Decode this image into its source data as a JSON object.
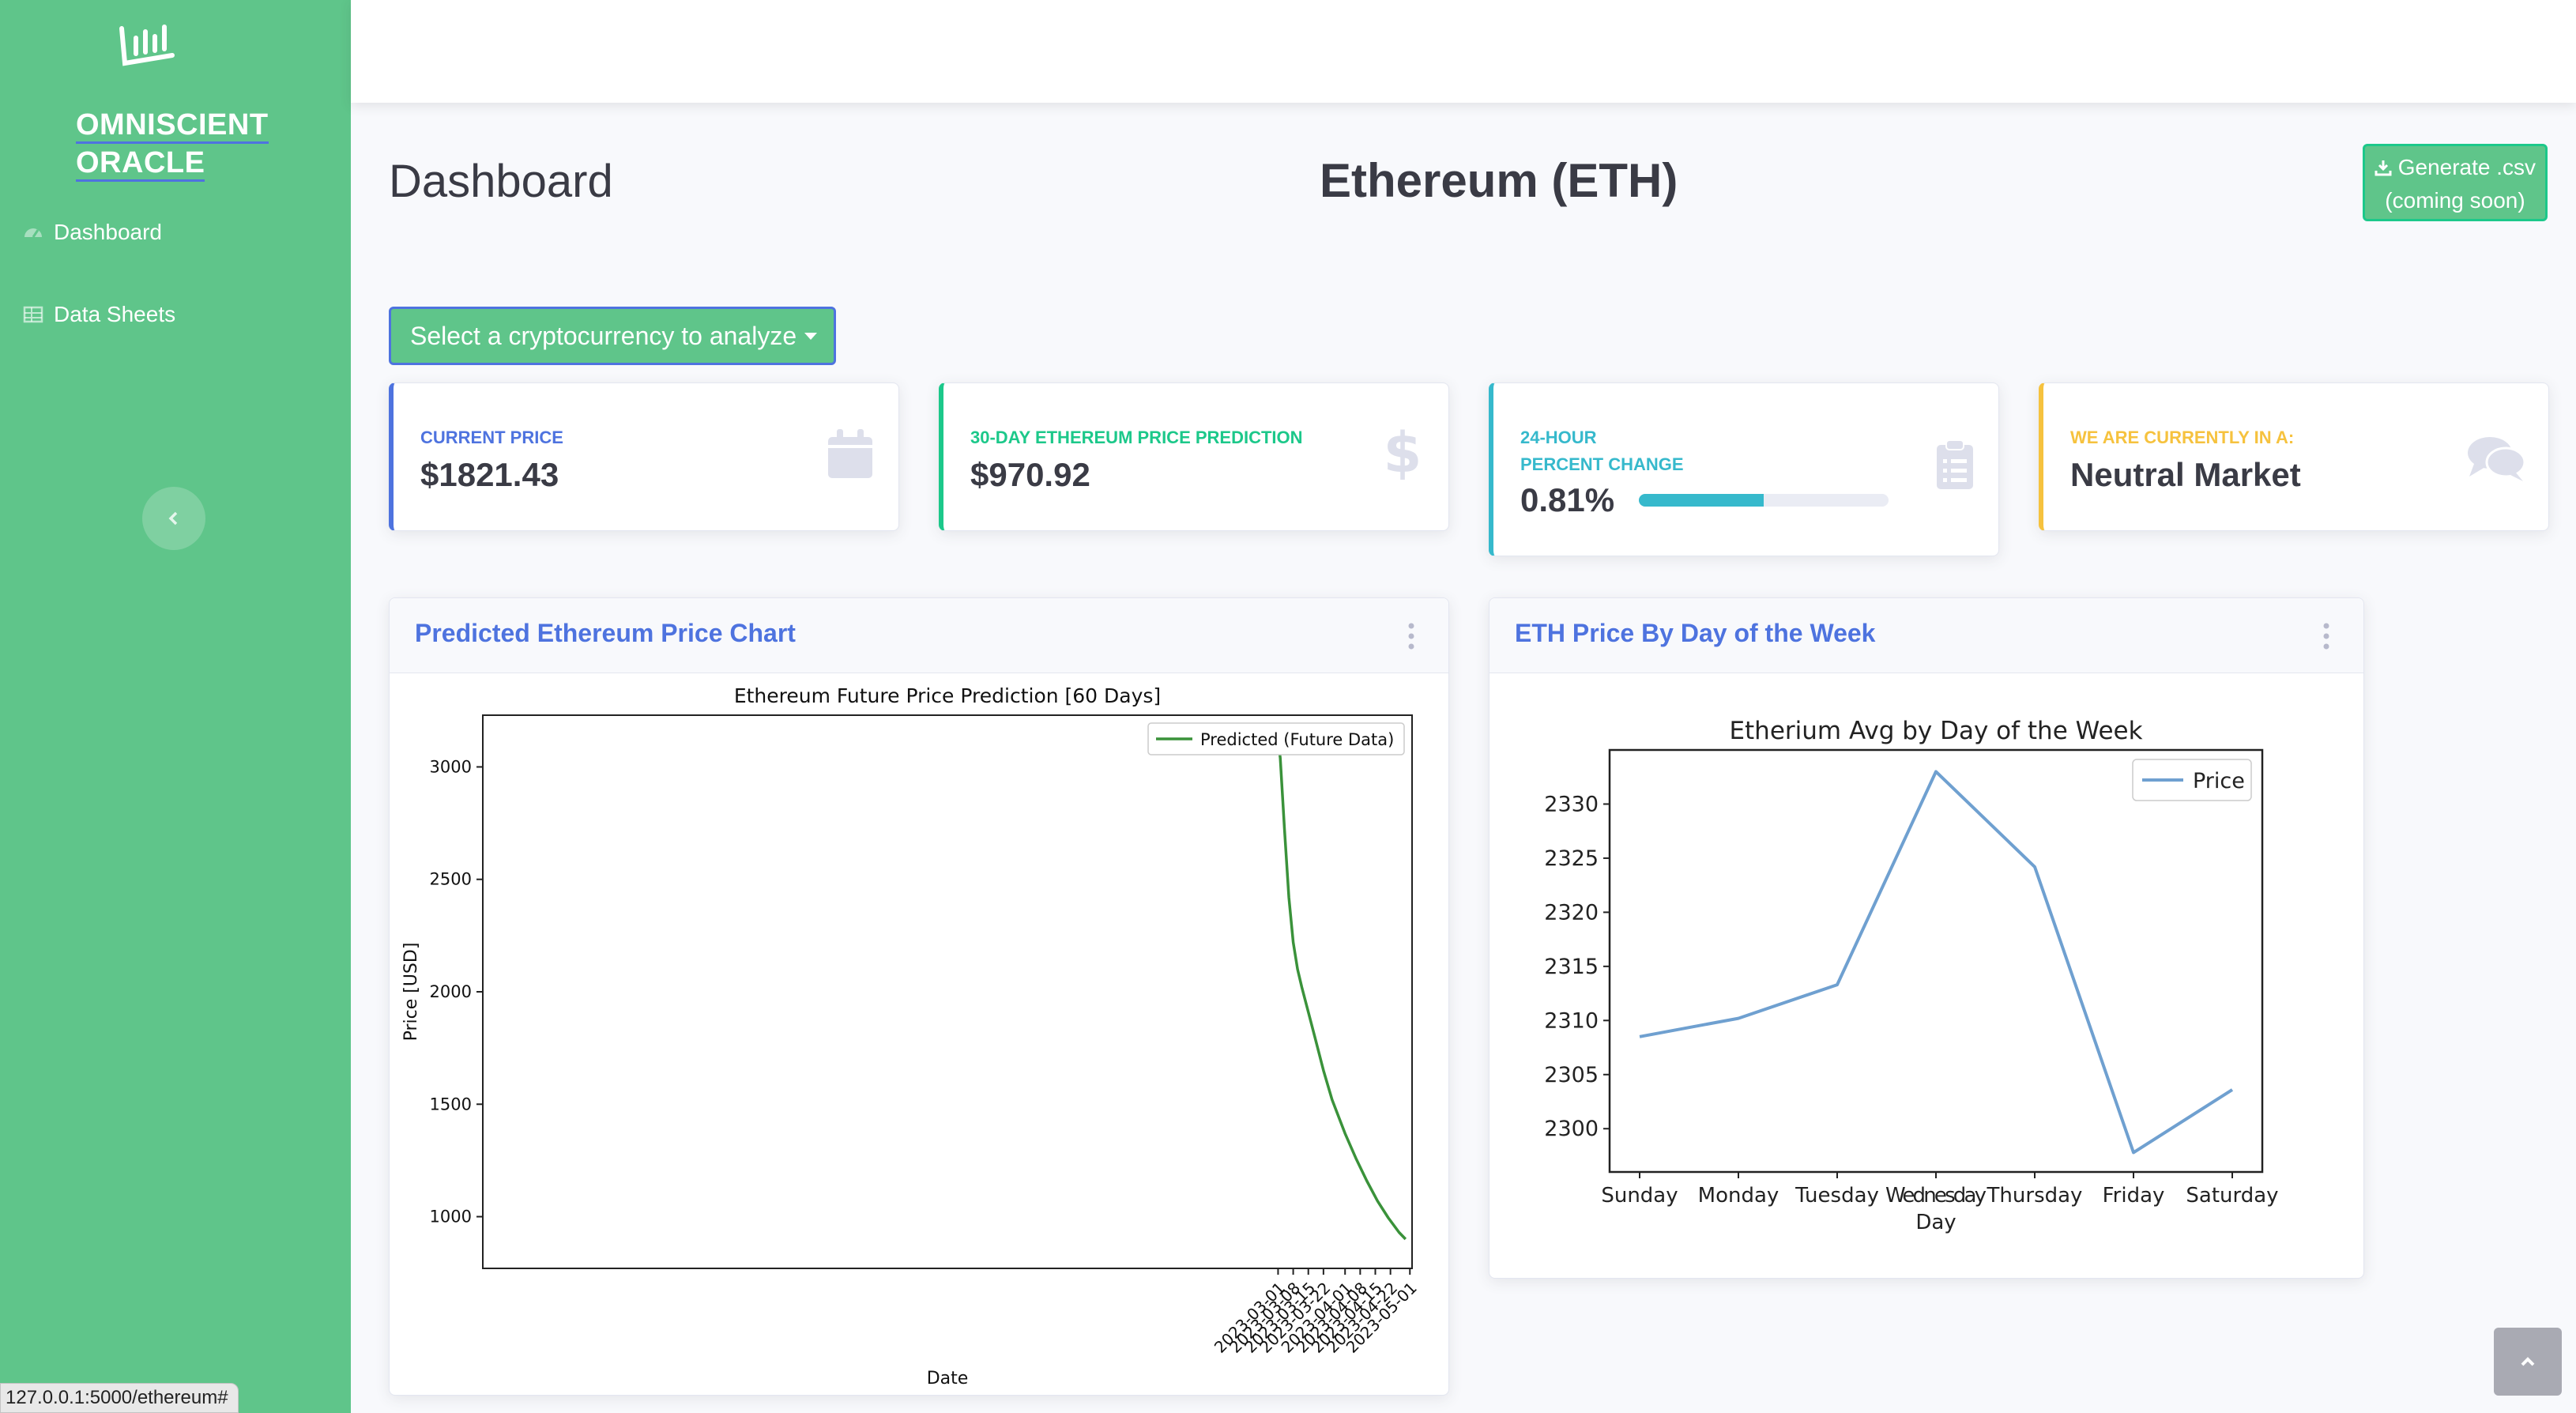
{
  "sidebar": {
    "brand_line1": "OMNISCIENT",
    "brand_line2": "ORACLE",
    "items": [
      {
        "label": "Dashboard",
        "icon": "tachometer-icon"
      },
      {
        "label": "Data Sheets",
        "icon": "table-icon"
      }
    ]
  },
  "header": {
    "page_title": "Dashboard",
    "coin_title": "Ethereum (ETH)",
    "generate_line1": "Generate .csv",
    "generate_line2": "(coming soon)",
    "select_label": "Select a cryptocurrency to analyze"
  },
  "stats": [
    {
      "label": "CURRENT PRICE",
      "value": "$1821.43",
      "color": "#4e73df",
      "icon": "calendar-icon"
    },
    {
      "label": "30-DAY ETHEREUM PRICE PREDICTION",
      "value": "$970.92",
      "color": "#1cc88a",
      "icon": "dollar-icon"
    },
    {
      "label_line1": "24-HOUR",
      "label_line2": "PERCENT CHANGE",
      "value": "0.81%",
      "progress": 0.5,
      "color": "#36b9cc",
      "icon": "clipboard-icon"
    },
    {
      "label": "WE ARE CURRENTLY IN A:",
      "value": "Neutral Market",
      "color": "#f6c23e",
      "icon": "comments-icon"
    }
  ],
  "charts": {
    "prediction_card_title": "Predicted Ethereum Price Chart",
    "weekday_card_title": "ETH Price By Day of the Week"
  },
  "chart_data": [
    {
      "type": "line",
      "title": "Ethereum Future Price Prediction [60 Days]",
      "xlabel": "Date",
      "ylabel": "Price [USD]",
      "legend": "top-right",
      "series": [
        {
          "name": "Predicted (Future Data)",
          "color": "#3a923a",
          "x": [
            "2023-03-01",
            "2023-03-02",
            "2023-03-04",
            "2023-03-06",
            "2023-03-08",
            "2023-03-10",
            "2023-03-12",
            "2023-03-15",
            "2023-03-18",
            "2023-03-22",
            "2023-03-26",
            "2023-04-01",
            "2023-04-06",
            "2023-04-11",
            "2023-04-16",
            "2023-04-21",
            "2023-04-26",
            "2023-04-29"
          ],
          "y": [
            3120,
            3040,
            2720,
            2420,
            2220,
            2100,
            2020,
            1910,
            1800,
            1650,
            1520,
            1370,
            1260,
            1160,
            1070,
            995,
            930,
            900
          ]
        }
      ],
      "x_ticks": [
        "2023-03-01",
        "2023-03-08",
        "2023-03-15",
        "2023-03-22",
        "2023-04-01",
        "2023-04-08",
        "2023-04-15",
        "2023-04-22",
        "2023-05-01"
      ],
      "x_range": [
        "2022-02-26",
        "2023-05-02"
      ],
      "y_ticks": [
        1000,
        1500,
        2000,
        2500,
        3000
      ],
      "ylim": [
        770,
        3230
      ]
    },
    {
      "type": "line",
      "title": "Etherium Avg by Day of the Week",
      "xlabel": "Day",
      "legend": "top-right",
      "categories": [
        "Sunday",
        "Monday",
        "Tuesday",
        "Wednesday",
        "Thursday",
        "Friday",
        "Saturday"
      ],
      "series": [
        {
          "name": "Price",
          "color": "#6fa0d0",
          "values": [
            2308.5,
            2310.2,
            2313.3,
            2333,
            2324.2,
            2297.8,
            2303.6
          ]
        }
      ],
      "y_ticks": [
        2300,
        2305,
        2310,
        2315,
        2320,
        2325,
        2330
      ],
      "ylim": [
        2296,
        2335
      ]
    }
  ],
  "statusbar": {
    "url": "127.0.0.1:5000/ethereum#"
  }
}
